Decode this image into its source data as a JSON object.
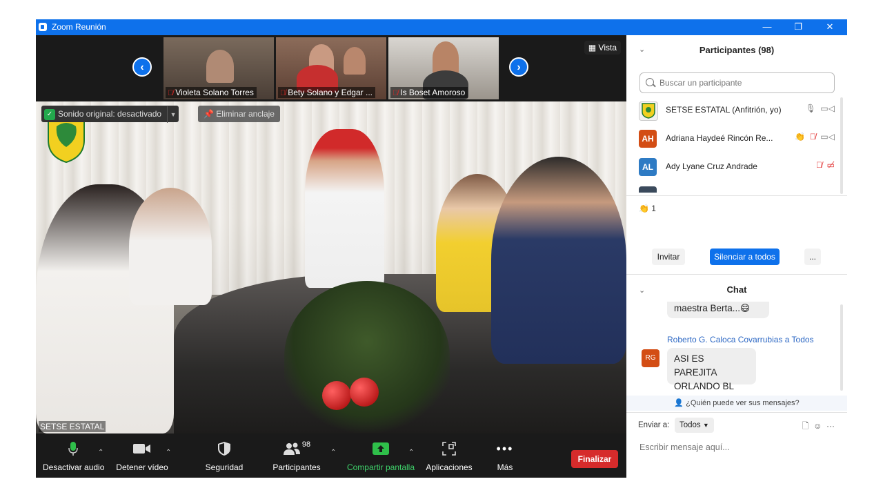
{
  "window": {
    "title": "Zoom Reunión",
    "controls": [
      "—",
      "❐",
      "✕"
    ]
  },
  "strip": {
    "vista_label": "Vista",
    "thumbnails": [
      {
        "name": "Violeta Solano Torres"
      },
      {
        "name": "Bety Solano y Edgar ..."
      },
      {
        "name": "Is Boset Amoroso"
      }
    ]
  },
  "main_video": {
    "original_sound_label": "Sonido original: desactivado",
    "unpin_label": "Eliminar anclaje",
    "speaker_name": "SETSE ESTATAL"
  },
  "toolbar": {
    "audio": "Desactivar audio",
    "video": "Detener vídeo",
    "security": "Seguridad",
    "participants": "Participantes",
    "participants_count": "98",
    "share": "Compartir pantalla",
    "apps": "Aplicaciones",
    "more": "Más",
    "end": "Finalizar"
  },
  "participants_panel": {
    "title": "Participantes (98)",
    "search_placeholder": "Buscar un participante",
    "rows": [
      {
        "initials": "",
        "name": "SETSE ESTATAL (Anfitrión, yo)",
        "color": "#e8e8e8"
      },
      {
        "initials": "AH",
        "name": "Adriana Haydeé Rincón Re...",
        "color": "#d34d14"
      },
      {
        "initials": "AL",
        "name": "Ady Lyane Cruz Andrade",
        "color": "#2e7bc4"
      }
    ],
    "reaction_count": "1",
    "invite": "Invitar",
    "mute_all": "Silenciar a todos",
    "more": "..."
  },
  "chat_panel": {
    "title": "Chat",
    "prev_message": "maestra Berta...😄",
    "sender": "Roberto G. Caloca Covarrubias a Todos",
    "sender_initials": "RG",
    "message_line1": "ASI ES PAREJITA",
    "message_line2": "ORLANDO BL",
    "who_can_see": "¿Quién puede ver sus mensajes?",
    "send_to_label": "Enviar a:",
    "send_to_value": "Todos",
    "input_placeholder": "Escribir mensaje aquí..."
  }
}
